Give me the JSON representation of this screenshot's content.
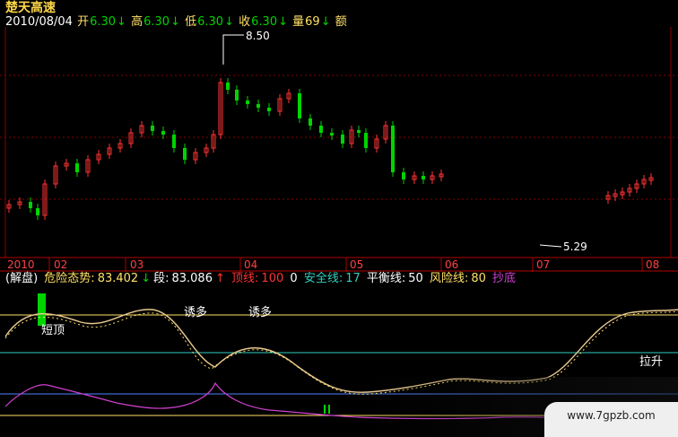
{
  "header": {
    "title": "楚天高速",
    "date": "2010/08/04",
    "open_label": "开",
    "open_value": "6.30",
    "high_label": "高",
    "high_value": "6.30",
    "low_label": "低",
    "low_value": "6.30",
    "close_label": "收",
    "close_value": "6.30",
    "volume_label": "量",
    "volume_value": "69",
    "amount_label": "额",
    "arrow": "↓"
  },
  "price_chart": {
    "high_marker": "8.50",
    "low_marker": "5.29"
  },
  "x_axis": {
    "labels": [
      "2010",
      "02",
      "03",
      "04",
      "05",
      "06",
      "07",
      "08"
    ]
  },
  "indicator_bar": {
    "mode": "(解盘)",
    "risk_trend_label": "危险态势:",
    "risk_trend_value": "83.402",
    "arrow_down": "↓",
    "segment_label": "段:",
    "segment_value": "83.086",
    "arrow_up": "↑",
    "top_line_label": "顶线:",
    "top_line_value": "100",
    "zero": "0",
    "safe_line_label": "安全线:",
    "safe_line_value": "17",
    "balance_line_label": "平衡线:",
    "balance_line_value": "50",
    "risk_line_label": "风险线:",
    "risk_line_value": "80",
    "bottom_fish_label": "抄底"
  },
  "annotations": {
    "short_top": "短顶",
    "lure_long_1": "诱多",
    "lure_long_2": "诱多",
    "pull_up": "拉升"
  },
  "watermark": "www.7gpzb.com",
  "colors": {
    "up": "#ff3333",
    "down": "#00d400",
    "yellow": "#ffe066",
    "cyan": "#30d0c0",
    "blue": "#5080ff",
    "magenta": "#d040d0",
    "white": "#ffffff",
    "grid_red": "#a00000"
  }
}
